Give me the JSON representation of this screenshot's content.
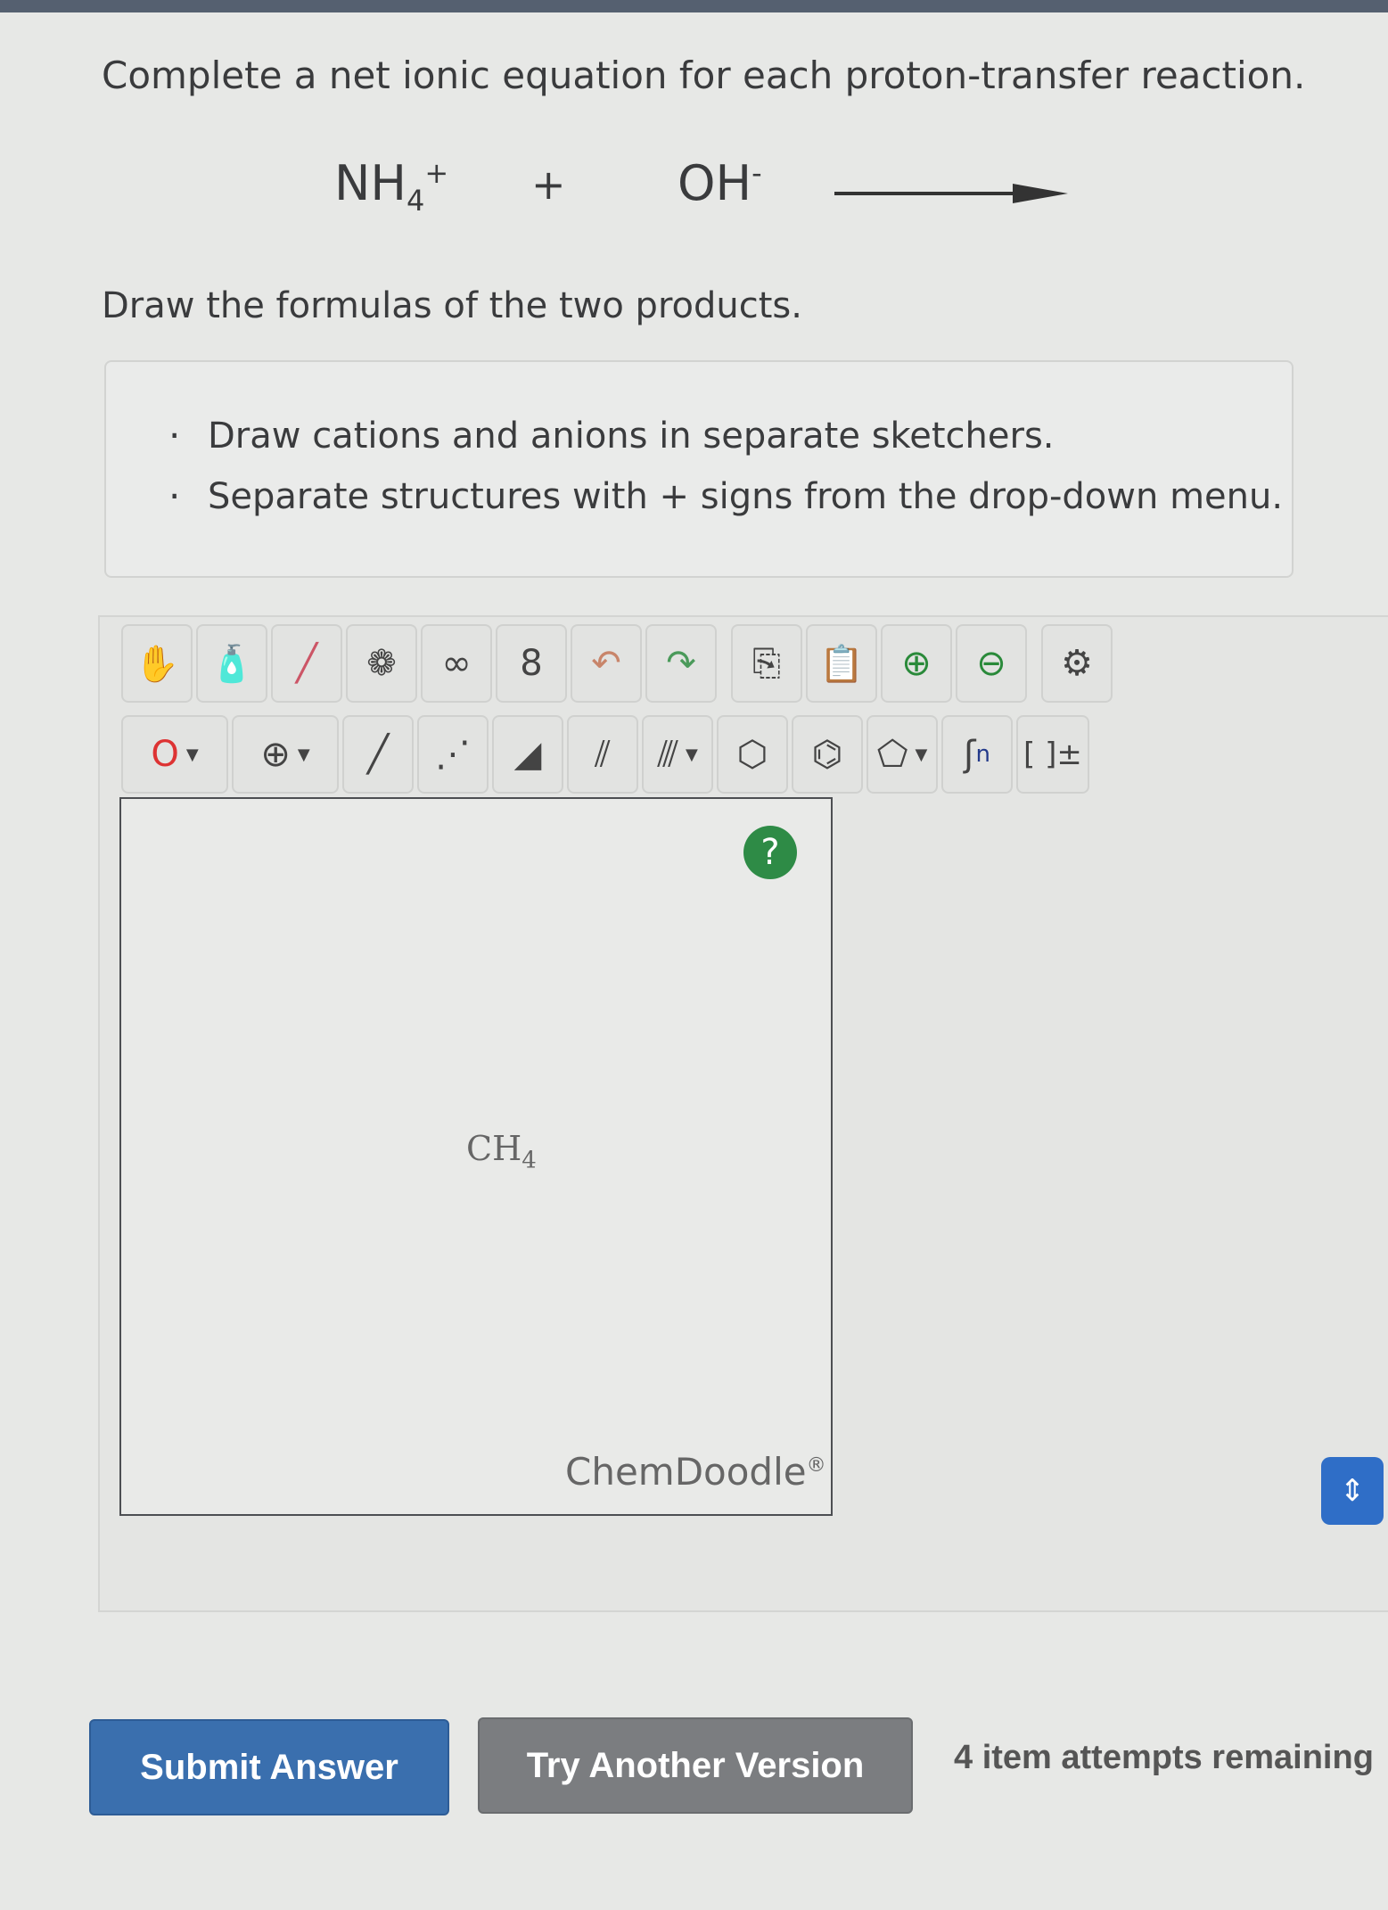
{
  "question": "Complete a net ionic equation for each proton-transfer reaction.",
  "equation": {
    "reactant1": {
      "base": "NH",
      "subscript": "4",
      "charge": "+"
    },
    "plus": "+",
    "reactant2": {
      "base": "OH",
      "charge": "-"
    }
  },
  "prompt": "Draw the formulas of the two products.",
  "instructions": [
    "Draw cations and anions in separate sketchers.",
    "Separate structures with + signs from the drop-down menu."
  ],
  "toolbar": {
    "row1": [
      "hand-icon",
      "clear-bottle-icon",
      "eraser-icon",
      "rotate-ring-icon",
      "clean-icon",
      "flip-icon",
      "undo-icon",
      "redo-icon",
      "copy-icon",
      "paste-icon",
      "zoom-in-icon",
      "zoom-out-icon",
      "settings-icon"
    ],
    "atom_label": "O",
    "charge_label": "⊕",
    "brackets_label": "[ ]±",
    "repeat_unit_label": "n"
  },
  "canvas": {
    "help_label": "?",
    "molecule": {
      "base": "CH",
      "subscript": "4"
    },
    "brand": "ChemDoodle",
    "brand_mark": "®"
  },
  "buttons": {
    "submit": "Submit Answer",
    "another": "Try Another Version"
  },
  "attempts": "4 item attempts remaining",
  "colors": {
    "submit": "#3a6fae",
    "another": "#7b7d80",
    "help": "#2e8b46",
    "scroll_control": "#2f6ec7"
  }
}
